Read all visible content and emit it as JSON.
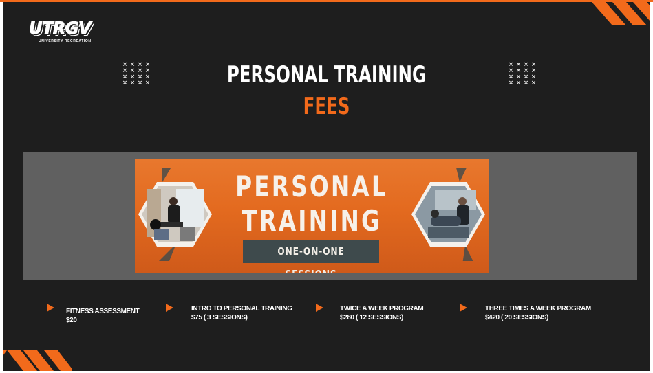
{
  "colors": {
    "accent": "#f26a1b",
    "background": "#1e1e1e",
    "band": "#606060",
    "banner_box": "#3e4a4c"
  },
  "logo": {
    "word": "UTRGV",
    "subtitle": "UNIVERSITY RECREATION"
  },
  "title": {
    "line1": "PERSONAL TRAINING",
    "line2": "FEES"
  },
  "banner": {
    "line1": "PERSONAL",
    "line2": "TRAINING",
    "tagline": "ONE-ON-ONE SESSIONS"
  },
  "fees": [
    {
      "name": "FITNESS ASSESSMENT",
      "price": "$20"
    },
    {
      "name": "INTRO TO PERSONAL TRAINING",
      "price": "$75 ( 3 SESSIONS)"
    },
    {
      "name": "TWICE A WEEK PROGRAM",
      "price": "$280 ( 12 SESSIONS)"
    },
    {
      "name": "THREE TIMES A WEEK PROGRAM",
      "price": "$420 ( 20 SESSIONS)"
    }
  ],
  "icons": [
    "x-pattern-icon",
    "stripe-decoration-icon",
    "arrow-right-icon",
    "hexagon-photo-icon"
  ]
}
